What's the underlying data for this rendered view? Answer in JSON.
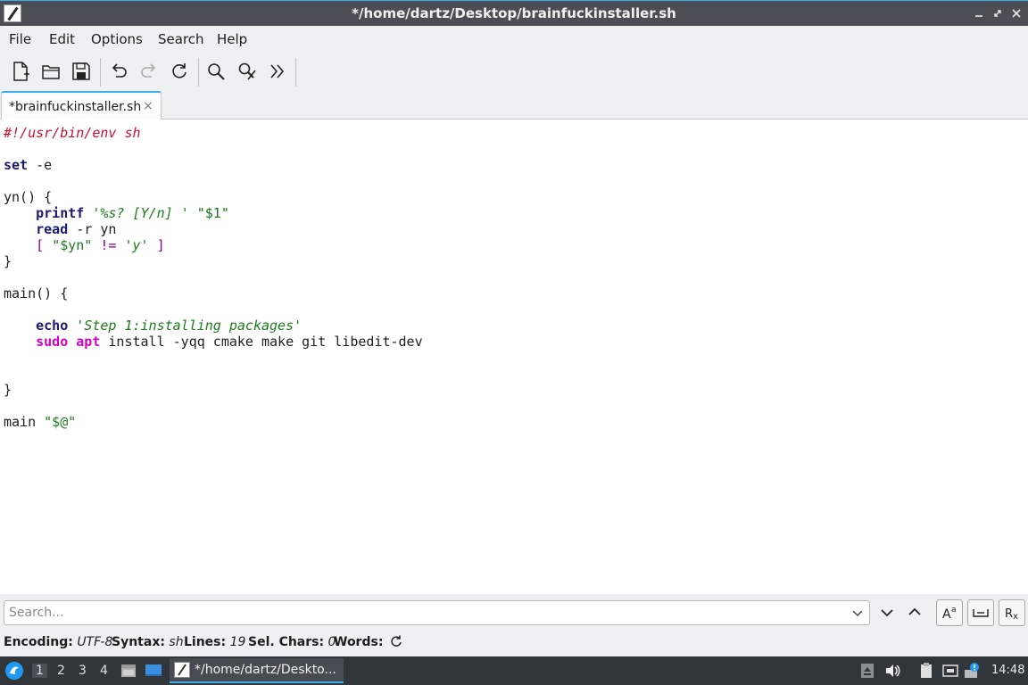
{
  "window": {
    "title": "*/home/dartz/Desktop/brainfuckinstaller.sh"
  },
  "menu": [
    "File",
    "Edit",
    "Options",
    "Search",
    "Help"
  ],
  "tab": {
    "label": "*brainfuckinstaller.sh",
    "close": "×"
  },
  "code": {
    "l1": "#!/usr/bin/env sh",
    "l3a": "set",
    "l3b": " -e",
    "l5": "yn() {",
    "l6a": "    ",
    "l6b": "printf",
    "l6c": " ",
    "l6d": "'%s? [Y/n] '",
    "l6e": " ",
    "l6f": "\"$1\"",
    "l7a": "    ",
    "l7b": "read",
    "l7c": " -r yn",
    "l8a": "    ",
    "l8b": "[",
    "l8c": " ",
    "l8d": "\"$yn\"",
    "l8e": " ",
    "l8f": "!=",
    "l8g": " ",
    "l8h": "'y'",
    "l8i": " ",
    "l8j": "]",
    "l9": "}",
    "l11": "main() {",
    "l13a": "    ",
    "l13b": "echo",
    "l13c": " ",
    "l13d": "'Step 1:installing packages'",
    "l14a": "    ",
    "l14b": "sudo",
    "l14c": " ",
    "l14d": "apt",
    "l14e": " install -yqq cmake make git libedit-dev",
    "l17": "}",
    "l19a": "main ",
    "l19b": "\"$@\""
  },
  "search": {
    "placeholder": "Search..."
  },
  "status": {
    "encoding_label": "Encoding:",
    "encoding_value": "UTF-8",
    "syntax_label": "Syntax:",
    "syntax_value": "sh",
    "lines_label": "Lines:",
    "lines_value": "19",
    "sel_label": "Sel. Chars:",
    "sel_value": "0",
    "words_label": "Words:"
  },
  "taskbar": {
    "workspaces": [
      "1",
      "2",
      "3",
      "4"
    ],
    "task_label": "*/home/dartz/Deskto...",
    "clock": "14:48"
  },
  "colors": {
    "accent": "#3daee9",
    "comment": "#c8102e",
    "string": "#1e7a1e",
    "keyword_magenta": "#d500c8"
  }
}
